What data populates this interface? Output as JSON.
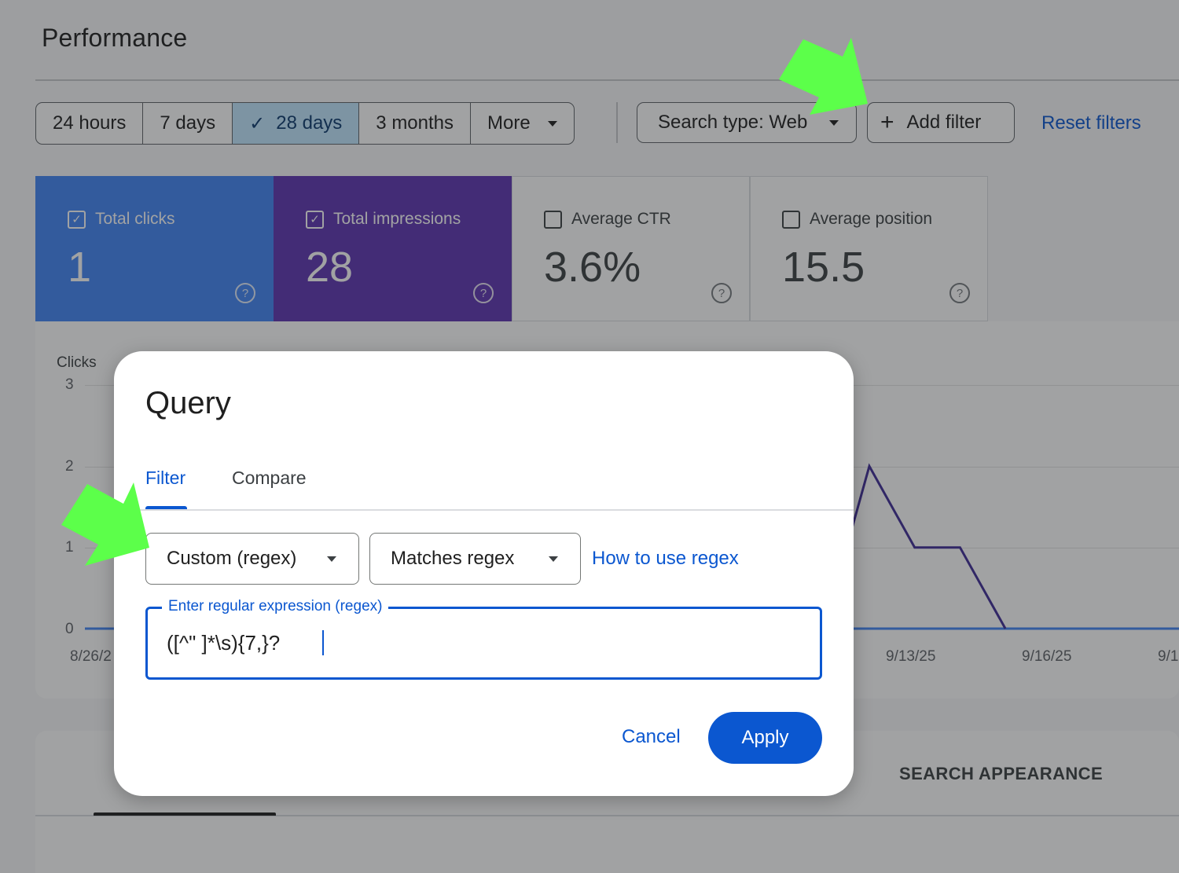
{
  "page": {
    "title": "Performance"
  },
  "date_range": {
    "options": [
      "24 hours",
      "7 days",
      "28 days",
      "3 months",
      "More"
    ],
    "selected": "28 days"
  },
  "filters": {
    "search_type": "Search type: Web",
    "add_filter": "Add filter",
    "reset": "Reset filters"
  },
  "metrics": [
    {
      "label": "Total clicks",
      "value": "1",
      "checked": true,
      "color": "#4285f4"
    },
    {
      "label": "Total impressions",
      "value": "28",
      "checked": true,
      "color": "#5e35b1"
    },
    {
      "label": "Average CTR",
      "value": "3.6%",
      "checked": false
    },
    {
      "label": "Average position",
      "value": "15.5",
      "checked": false
    }
  ],
  "chart_data": {
    "type": "line",
    "ylabel": "Clicks",
    "ylim": [
      0,
      3
    ],
    "yticks": [
      "3",
      "2",
      "1",
      "0"
    ],
    "xticks": [
      "8/26/2",
      "9/13/25",
      "9/16/25",
      "9/1"
    ],
    "series": [
      {
        "color": "#3f2b96",
        "x": [
          "9/12/25",
          "9/13/25",
          "9/14/25",
          "9/15/25",
          "9/16/25"
        ],
        "values": [
          0,
          2,
          1,
          1,
          0
        ]
      },
      {
        "color": "#4285f4",
        "values": [
          0
        ]
      }
    ],
    "grid": true
  },
  "bottom_tabs": {
    "search_appearance": "SEARCH APPEARANCE"
  },
  "dialog": {
    "title": "Query",
    "tabs": {
      "filter": "Filter",
      "compare": "Compare"
    },
    "dimension_select": "Custom (regex)",
    "operator_select": "Matches regex",
    "help_link": "How to use regex",
    "field_label": "Enter regular expression (regex)",
    "field_value": "([^\" ]*\\s){7,}?",
    "cancel": "Cancel",
    "apply": "Apply"
  },
  "annotations": {
    "arrow_color": "#5cff4a"
  }
}
